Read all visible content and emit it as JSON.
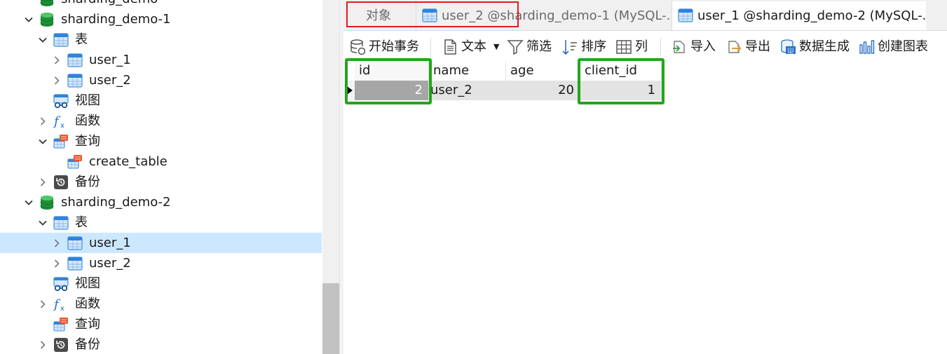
{
  "sidebar": {
    "items": [
      {
        "label": "sharding_demo",
        "icon": "database-icon",
        "chevron": "none",
        "depth": 1
      },
      {
        "label": "sharding_demo-1",
        "icon": "database-icon",
        "chevron": "down",
        "depth": 1
      },
      {
        "label": "表",
        "icon": "tables-folder-icon",
        "chevron": "down",
        "depth": 2
      },
      {
        "label": "user_1",
        "icon": "table-icon",
        "chevron": "right",
        "depth": 3
      },
      {
        "label": "user_2",
        "icon": "table-icon",
        "chevron": "right",
        "depth": 3
      },
      {
        "label": "视图",
        "icon": "view-icon",
        "chevron": "none",
        "depth": 2
      },
      {
        "label": "函数",
        "icon": "function-icon",
        "chevron": "right",
        "depth": 2
      },
      {
        "label": "查询",
        "icon": "query-icon",
        "chevron": "down",
        "depth": 2
      },
      {
        "label": "create_table",
        "icon": "query-item-icon",
        "chevron": "none",
        "depth": 3
      },
      {
        "label": "备份",
        "icon": "backup-icon",
        "chevron": "right",
        "depth": 2
      },
      {
        "label": "sharding_demo-2",
        "icon": "database-icon",
        "chevron": "down",
        "depth": 1
      },
      {
        "label": "表",
        "icon": "tables-folder-icon",
        "chevron": "down",
        "depth": 2
      },
      {
        "label": "user_1",
        "icon": "table-icon",
        "chevron": "right",
        "depth": 3,
        "selected": true
      },
      {
        "label": "user_2",
        "icon": "table-icon",
        "chevron": "right",
        "depth": 3
      },
      {
        "label": "视图",
        "icon": "view-icon",
        "chevron": "none",
        "depth": 2
      },
      {
        "label": "函数",
        "icon": "function-icon",
        "chevron": "right",
        "depth": 2
      },
      {
        "label": "查询",
        "icon": "query-icon",
        "chevron": "none",
        "depth": 2
      },
      {
        "label": "备份",
        "icon": "backup-icon",
        "chevron": "right",
        "depth": 2
      }
    ]
  },
  "tabs": [
    {
      "label": "对象",
      "icon": "none",
      "active": false
    },
    {
      "label": "user_2 @sharding_demo-1 (MySQL-...",
      "icon": "table-icon",
      "active": false
    },
    {
      "label": "user_1 @sharding_demo-2 (MySQL-...",
      "icon": "table-icon",
      "active": true
    }
  ],
  "toolbar": {
    "begin_transaction": "开始事务",
    "text": "文本",
    "filter": "筛选",
    "sort": "排序",
    "columns": "列",
    "import": "导入",
    "export": "导出",
    "data_generation": "数据生成",
    "create_chart": "创建图表"
  },
  "grid": {
    "columns": [
      "id",
      "name",
      "age",
      "client_id"
    ],
    "rows": [
      [
        "2",
        "user_2",
        "20",
        "1"
      ]
    ]
  },
  "colors": {
    "selection": "#cce8ff",
    "highlight_green": "#22a61d",
    "active_tab_outline": "#e21d1d"
  }
}
